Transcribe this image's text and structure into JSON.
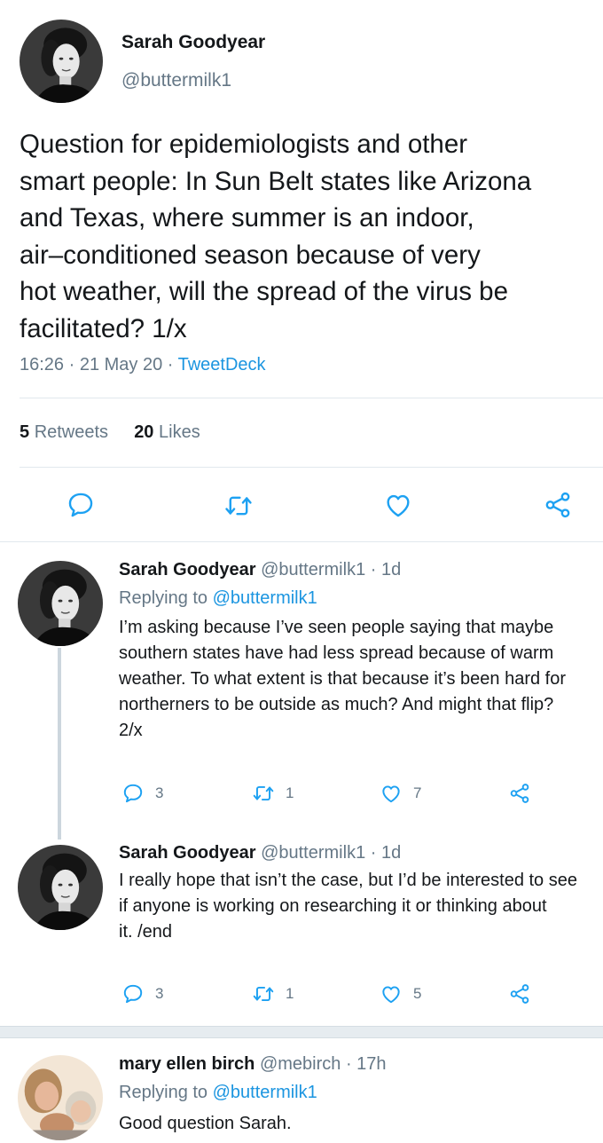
{
  "tweet": {
    "author_name": "Sarah Goodyear",
    "author_handle": "@buttermilk1",
    "text": "Question for epidemiologists and other\nsmart people: In Sun Belt states like Arizona\nand Texas, where summer is an indoor,\nair–conditioned season because of very\nhot weather, will the spread of the virus be\nfacilitated? 1/x",
    "time": "16:26 · 21 May 20 · ",
    "source": "TweetDeck",
    "retweets_count": "5",
    "retweets_label": "Retweets",
    "likes_count": "20",
    "likes_label": "Likes"
  },
  "replies": [
    {
      "name": "Sarah Goodyear",
      "handle": "@buttermilk1",
      "age": "· 1d",
      "replying_prefix": "Replying to ",
      "replying_handle": "@buttermilk1",
      "text": "I’m asking because I’ve seen people saying that maybe\nsouthern states have had less spread because of warm\nweather. To what extent is that because it’s been hard for\nnortherners to be outside as much? And might that flip?\n2/x",
      "replies_count": "3",
      "retweets_count": "1",
      "likes_count": "7"
    },
    {
      "name": "Sarah Goodyear",
      "handle": "@buttermilk1",
      "age": "· 1d",
      "text": "I really hope that isn’t the case, but I’d be interested to see\nif anyone is working on researching it or thinking about\nit. /end",
      "replies_count": "3",
      "retweets_count": "1",
      "likes_count": "5"
    },
    {
      "name": "mary ellen birch",
      "handle": "@mebirch",
      "age": "· 17h",
      "replying_prefix": "Replying to ",
      "replying_handle": "@buttermilk1",
      "text": "Good question Sarah."
    }
  ],
  "icons": {
    "reply": "speech-bubble-icon",
    "retweet": "retweet-arrows-icon",
    "like": "heart-icon",
    "share": "share-nodes-icon"
  },
  "colors": {
    "link": "#1b95e0",
    "muted": "#657786",
    "icon": "#1da1f2",
    "text": "#14171a"
  }
}
